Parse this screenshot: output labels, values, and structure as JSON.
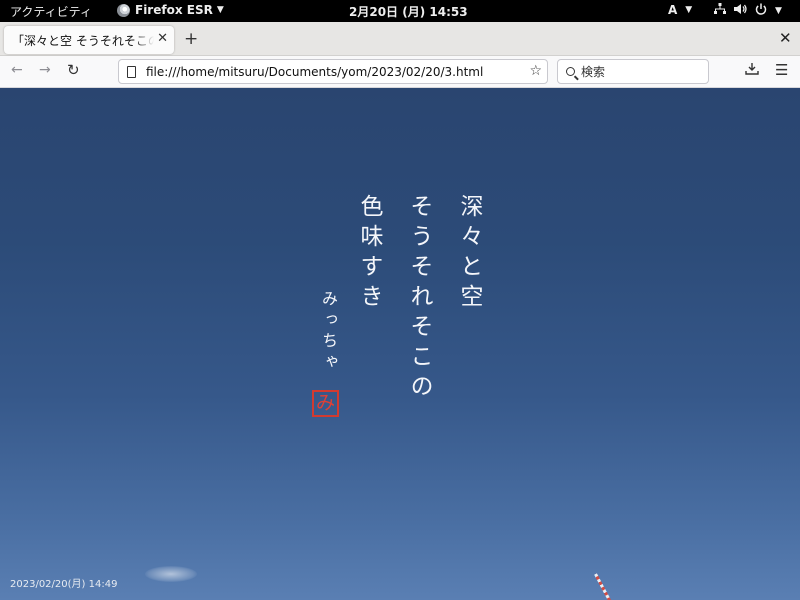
{
  "topbar": {
    "activities": "アクティビティ",
    "app_name": "Firefox ESR",
    "clock": "2月20日 (月)  14:53",
    "input_method": "A"
  },
  "browser": {
    "tab_title": "「深々と空 そうそれそこの 色",
    "address": "file:///home/mitsuru/Documents/yom/2023/02/20/3.html",
    "search_placeholder": "検索"
  },
  "page": {
    "poem_lines": [
      "深々と空",
      "そうそれそこの",
      "色味すき"
    ],
    "author": "みっちゃ",
    "seal": "み",
    "timestamp": "2023/02/20(月) 14:49"
  },
  "colors": {
    "sky_top": "#2a4570",
    "sky_bottom": "#5a7fb3",
    "seal_red": "#d23a30"
  }
}
